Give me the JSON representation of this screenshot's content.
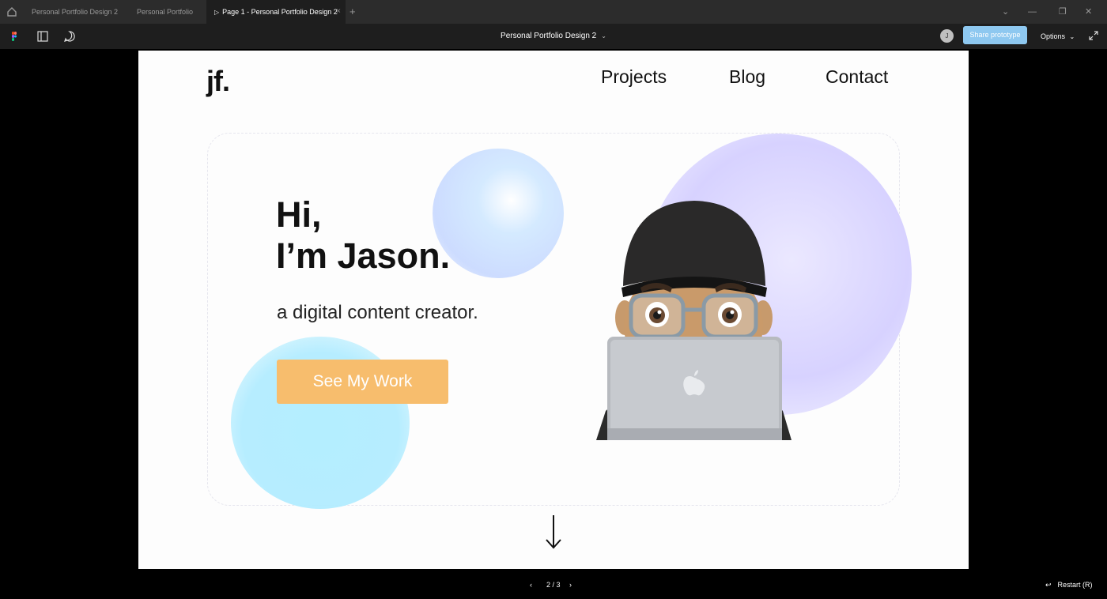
{
  "tabs": [
    {
      "label": "Personal Portfolio Design 2",
      "active": false
    },
    {
      "label": "Personal Portfolio",
      "active": false
    },
    {
      "label": "Page 1 - Personal Portfolio Design 2",
      "active": true
    }
  ],
  "tab_close": "×",
  "tab_add": "+",
  "window_controls": {
    "dropdown": "⌄",
    "minimize": "—",
    "maximize": "❐",
    "close": "✕"
  },
  "toolbar": {
    "file_title": "Personal Portfolio Design 2",
    "title_chevron": "⌄",
    "avatar_initial": "J",
    "share_label": "Share prototype",
    "options_label": "Options",
    "options_chevron": "⌄"
  },
  "site": {
    "logo": "jf.",
    "nav": [
      "Projects",
      "Blog",
      "Contact"
    ],
    "greeting_line1": "Hi,",
    "greeting_line2": "I’m Jason.",
    "subtitle": "a digital content creator.",
    "cta_label": "See My Work"
  },
  "footer": {
    "prev": "‹",
    "page_indicator": "2 / 3",
    "next": "›",
    "restart_icon": "↩",
    "restart_label": "Restart (R)"
  },
  "colors": {
    "accent_button": "#f7bd6d",
    "share_button": "#8ec8f0",
    "blob_lavender": "#d7d2ff",
    "blob_cyan": "#b2ecff"
  },
  "icons": [
    "home-icon",
    "figma-logo-icon",
    "sidebar-toggle-icon",
    "comment-icon",
    "expand-icon",
    "down-arrow-icon",
    "laptop-apple-logo"
  ]
}
